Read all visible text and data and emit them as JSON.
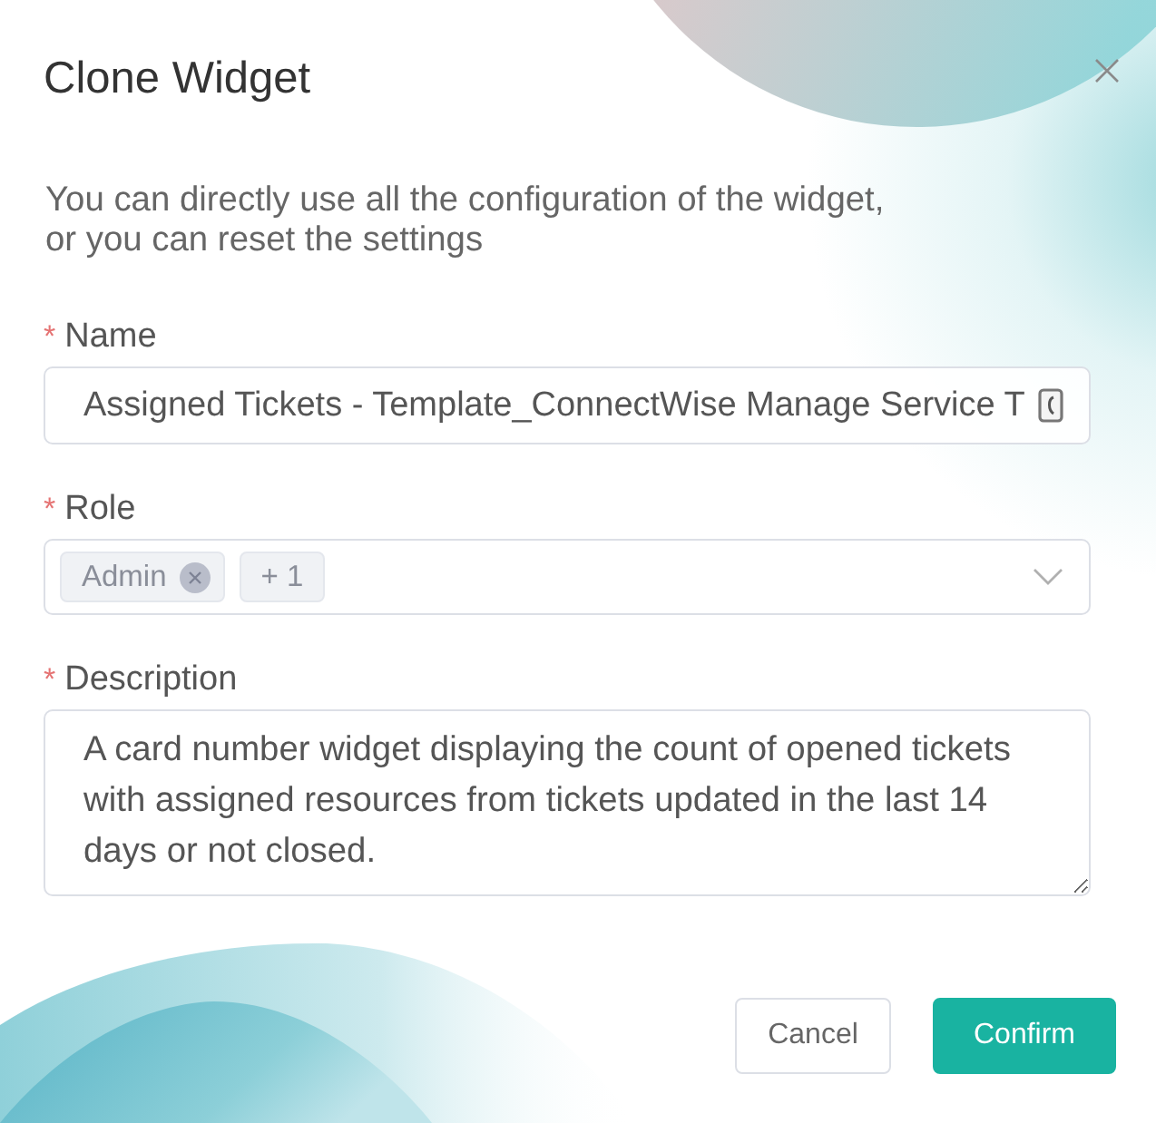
{
  "dialog": {
    "title": "Clone Widget",
    "intro": "You can directly use all the configuration of the widget,\nor you can reset the settings"
  },
  "fields": [
    {
      "kind": "text",
      "required_mark": "*",
      "label": "Name",
      "value": "Assigned Tickets - Template_ConnectWise Manage Service T"
    },
    {
      "kind": "select",
      "required_mark": "*",
      "label": "Role",
      "tags": [
        {
          "label": "Admin",
          "removable": true
        },
        {
          "label": "+ 1",
          "removable": false
        }
      ]
    },
    {
      "kind": "textarea",
      "required_mark": "*",
      "label": "Description",
      "value": "A card number widget displaying the count of opened tickets with assigned resources from tickets updated in the last 14 days or not closed."
    }
  ],
  "buttons": [
    {
      "label": "Cancel",
      "kind": "secondary"
    },
    {
      "label": "Confirm",
      "kind": "primary"
    }
  ]
}
